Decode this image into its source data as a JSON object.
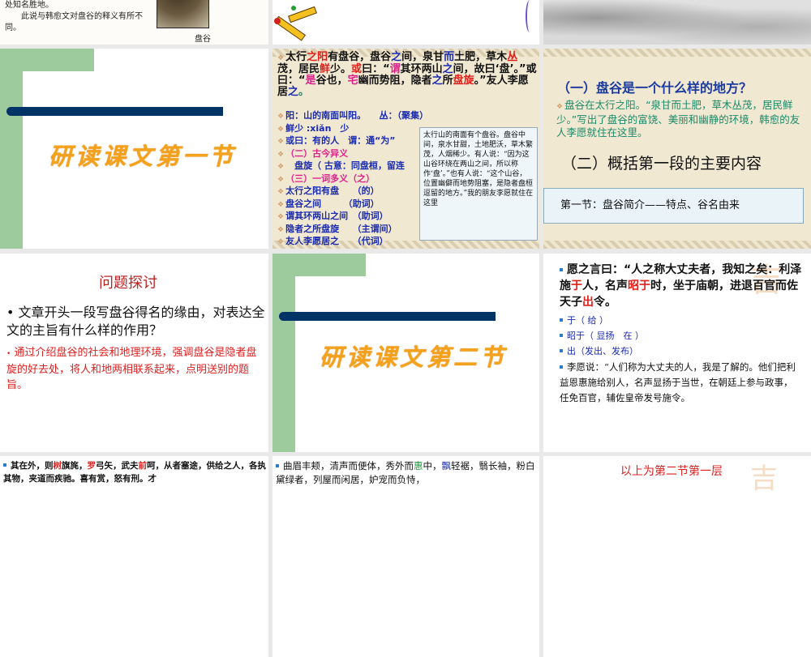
{
  "slides": {
    "s1": {
      "lines": [
        "处知名胜地。",
        "此说与韩愈文对盘谷的释义有所不同。"
      ],
      "caption": "盘谷"
    },
    "s4": {
      "title": "研读课文第一节"
    },
    "s5": {
      "passage": [
        [
          "太行",
          "之阳",
          "有盘谷，盘谷",
          "之",
          "间，泉甘",
          "而",
          "土肥，草木"
        ],
        [
          "丛",
          "茂，居民",
          "鲜",
          "少。",
          "或",
          "曰：“",
          "谓",
          "其环两山",
          "之",
          "间，故曰‘盘’。”或曰：“",
          "是",
          "谷也，",
          "宅",
          "幽而势阻，隐者",
          "之",
          "所",
          "盘旋",
          "。”友人李愿居",
          "之",
          "。"
        ]
      ],
      "notes": [
        "阳：山的南面叫阳。　　丛：（聚集）",
        "鲜少 :xiǎn　少",
        "或曰：有的人　谓：通“为”",
        "（二）古今异义",
        "　盘旋（ 古意：同盘桓，留连",
        "（三）一词多义（之）",
        "太行之阳有盘　　（的）",
        "盘谷之间　　　（助词）",
        "谓其环两山之间　（助词）",
        "隐者之所盘旋　　（主谓间）",
        "友人李愿居之　　（代词）"
      ],
      "popup": "太行山的南面有个盘谷。盘谷中间，泉水甘甜，土地肥沃，草木繁茂，人烟稀少。有人说：“因为这山谷环绕在两山之间，所以称作‘盘’。”也有人说：“这个山谷，位置幽僻而地势阻塞，是隐者盘桓逗留的地方。”我的朋友李愿就住在这里"
    },
    "s6": {
      "q1": "（一）盘谷是一个什么样的地方？",
      "a1": "盘谷在太行之阳。“泉甘而土肥，草木丛茂，居民鲜少。”写出了盘谷的富饶、美丽和幽静的环境，韩愈的友人李愿就住在这里。",
      "q2": "（二）概括第一段的主要内容",
      "box": "第一节：盘谷简介——特点、谷名由来"
    },
    "s7": {
      "title": "问题探讨",
      "q": "文章开头一段写盘谷得名的缘由，对表达全文的主旨有什么样的作用？",
      "a": "通过介绍盘谷的社会和地理环境，强调盘谷是隐者盘旋的好去处，将人和地两相联系起来，点明送别的题旨。"
    },
    "s8": {
      "title": "研读课文第二节"
    },
    "s9": {
      "quote": [
        "愿之言曰：“人之称大丈夫者，我知之矣：利泽施",
        "于",
        "人，名声",
        "昭于",
        "时，坐于庙朝，进退百官而佐天子",
        "出",
        "令。"
      ],
      "items": [
        "于（ 给 ）",
        "昭于（ 显扬　在 ）",
        "出（发出、发布）"
      ],
      "trans": "李愿说：“人们称为大丈夫的人，我是了解的。他们把利益恩惠施给别人，名声显扬于当世，在朝廷上参与政事，任免百官，辅佐皇帝发号施令。"
    },
    "s10": {
      "text": [
        "其在外，则",
        "树",
        "旗旄，",
        "罗",
        "弓矢，武夫",
        "前",
        "呵，从者塞途，供给之人，各执其物，夹道而疾驰。喜有赏，怒有刑。才"
      ]
    },
    "s11": {
      "text": [
        "曲眉丰颊，清声而便体，秀外而",
        "惠",
        "中，",
        "飘",
        "轻裾，翳长袖，粉白黛绿者，列屋而闲居，妒宠而负恃，"
      ]
    },
    "s12": {
      "title": "以上为第二节第一层"
    }
  }
}
